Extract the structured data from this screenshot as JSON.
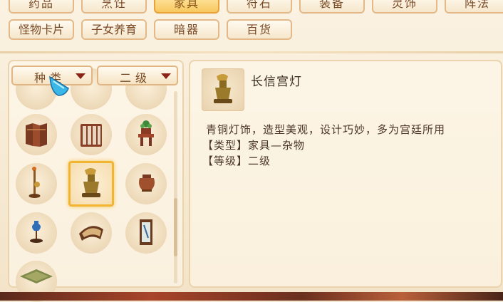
{
  "tabs_row1": [
    {
      "label": "药品",
      "active": false
    },
    {
      "label": "烹饪",
      "active": false
    },
    {
      "label": "家具",
      "active": true
    },
    {
      "label": "符石",
      "active": false
    },
    {
      "label": "装备",
      "active": false
    },
    {
      "label": "灵饰",
      "active": false
    },
    {
      "label": "阵法",
      "active": false
    }
  ],
  "tabs_row2": [
    {
      "label": "怪物卡片"
    },
    {
      "label": "子女养育"
    },
    {
      "label": "暗器"
    },
    {
      "label": "百货"
    }
  ],
  "filters": {
    "type_label": "种类",
    "grade_label": "二级"
  },
  "grid_items": [
    {
      "icon": "folding-screen-icon"
    },
    {
      "icon": "tall-screen-icon"
    },
    {
      "icon": "potted-plant-stand-icon"
    },
    {
      "icon": "candle-stand-icon"
    },
    {
      "icon": "bronze-palace-lamp-icon",
      "selected": true
    },
    {
      "icon": "bronze-pot-icon"
    },
    {
      "icon": "blue-vase-stand-icon"
    },
    {
      "icon": "fan-screen-icon"
    },
    {
      "icon": "hanging-scroll-icon"
    },
    {
      "icon": "floor-mat-icon"
    }
  ],
  "detail": {
    "name": "长信宫灯",
    "description": "青铜灯饰，造型美观，设计巧妙，多为宫廷所用",
    "type_line": "【类型】家具—杂物",
    "grade_line": "【等级】二级"
  },
  "colors": {
    "accent": "#f2b531",
    "text_brown": "#7a4a26",
    "arrow_red": "#8a2418"
  }
}
